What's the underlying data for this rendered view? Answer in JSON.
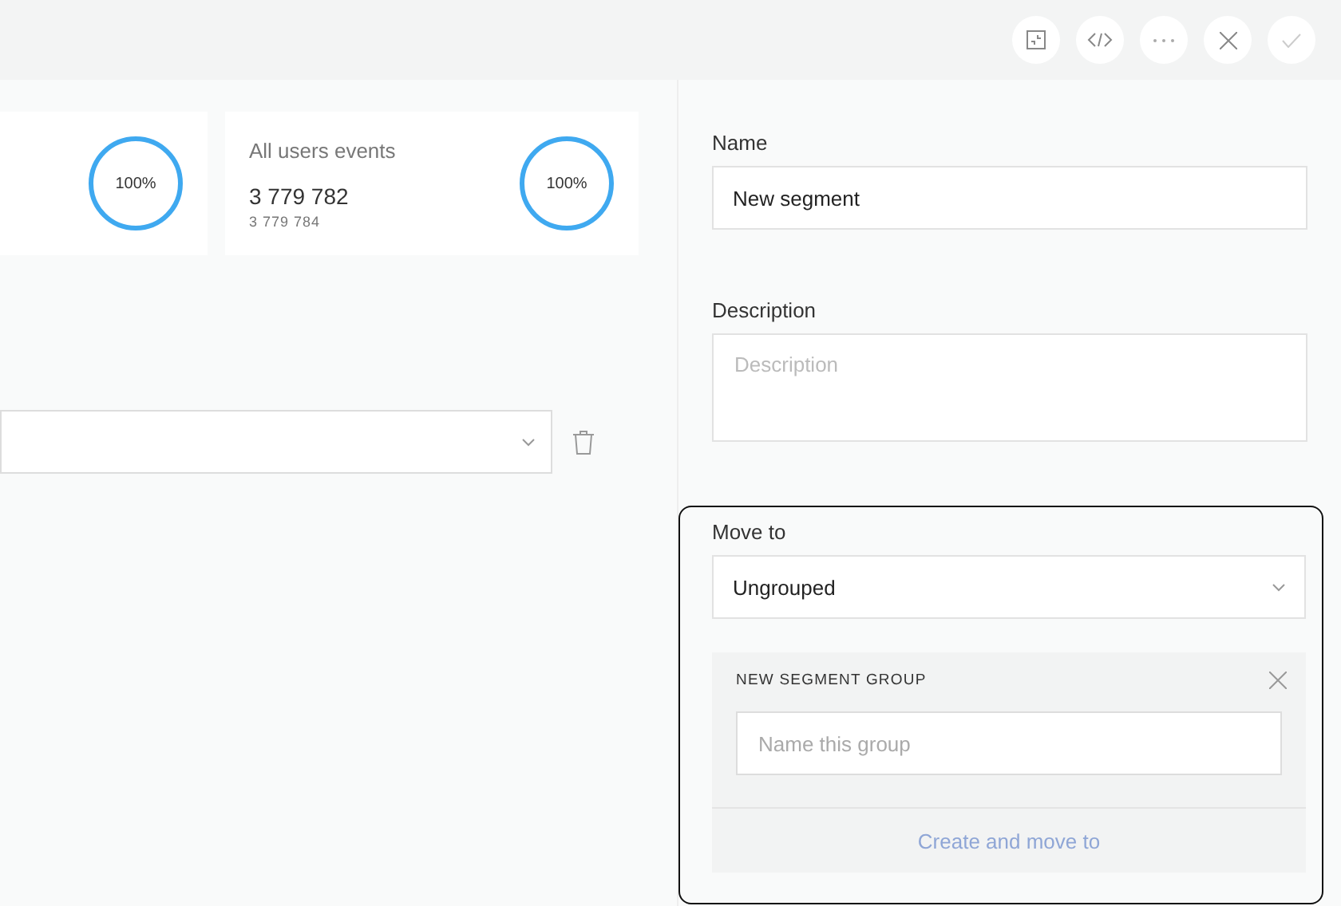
{
  "toolbar": {
    "buttons": [
      {
        "kind": "collapse"
      },
      {
        "kind": "code"
      },
      {
        "kind": "more"
      },
      {
        "kind": "close"
      },
      {
        "kind": "confirm"
      }
    ]
  },
  "stats": [
    {
      "percent": "100%",
      "level": 1
    },
    {
      "title": "All users events",
      "value": "3 779 782",
      "subvalue": "3 779 784",
      "percent": "100%",
      "level": 1
    }
  ],
  "form": {
    "name": {
      "label": "Name",
      "value": "New segment"
    },
    "description": {
      "label": "Description",
      "placeholder": "Description"
    },
    "move_to": {
      "label": "Move to",
      "value": "Ungrouped"
    },
    "new_group": {
      "title": "NEW SEGMENT GROUP",
      "placeholder": "Name this group",
      "button": "Create and move to"
    }
  }
}
